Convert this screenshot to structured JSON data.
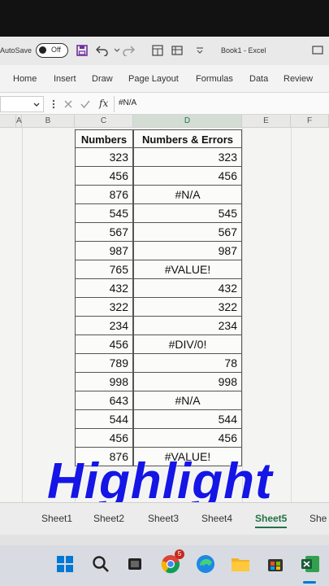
{
  "titlebar": {
    "autosave_label": "AutoSave",
    "autosave_state": "Off",
    "title": "Book1 - Excel"
  },
  "ribbon": {
    "tabs": [
      "Home",
      "Insert",
      "Draw",
      "Page Layout",
      "Formulas",
      "Data",
      "Review"
    ]
  },
  "formula_bar": {
    "fx_label": "fx",
    "formula": "#N/A"
  },
  "columns": [
    "A",
    "B",
    "C",
    "D",
    "E",
    "F"
  ],
  "active_column": "D",
  "table": {
    "headers": [
      "Numbers",
      "Numbers & Errors"
    ],
    "rows": [
      [
        "323",
        "323"
      ],
      [
        "456",
        "456"
      ],
      [
        "876",
        "#N/A"
      ],
      [
        "545",
        "545"
      ],
      [
        "567",
        "567"
      ],
      [
        "987",
        "987"
      ],
      [
        "765",
        "#VALUE!"
      ],
      [
        "432",
        "432"
      ],
      [
        "322",
        "322"
      ],
      [
        "234",
        "234"
      ],
      [
        "456",
        "#DIV/0!"
      ],
      [
        "789",
        "78"
      ],
      [
        "998",
        "998"
      ],
      [
        "643",
        "#N/A"
      ],
      [
        "544",
        "544"
      ],
      [
        "456",
        "456"
      ],
      [
        "876",
        "#VALUE!"
      ]
    ]
  },
  "overlay": {
    "text": "Highlight",
    "color": "#1515e6"
  },
  "sheets": {
    "tabs": [
      "Sheet1",
      "Sheet2",
      "Sheet3",
      "Sheet4",
      "Sheet5",
      "She"
    ],
    "active": "Sheet5"
  },
  "taskbar": {
    "icons": [
      "windows-start-icon",
      "search-icon",
      "task-view-icon",
      "chrome-icon",
      "edge-icon",
      "file-explorer-icon",
      "store-icon",
      "excel-icon"
    ],
    "chrome_badge": "5"
  },
  "colors": {
    "excel_green": "#217346"
  }
}
